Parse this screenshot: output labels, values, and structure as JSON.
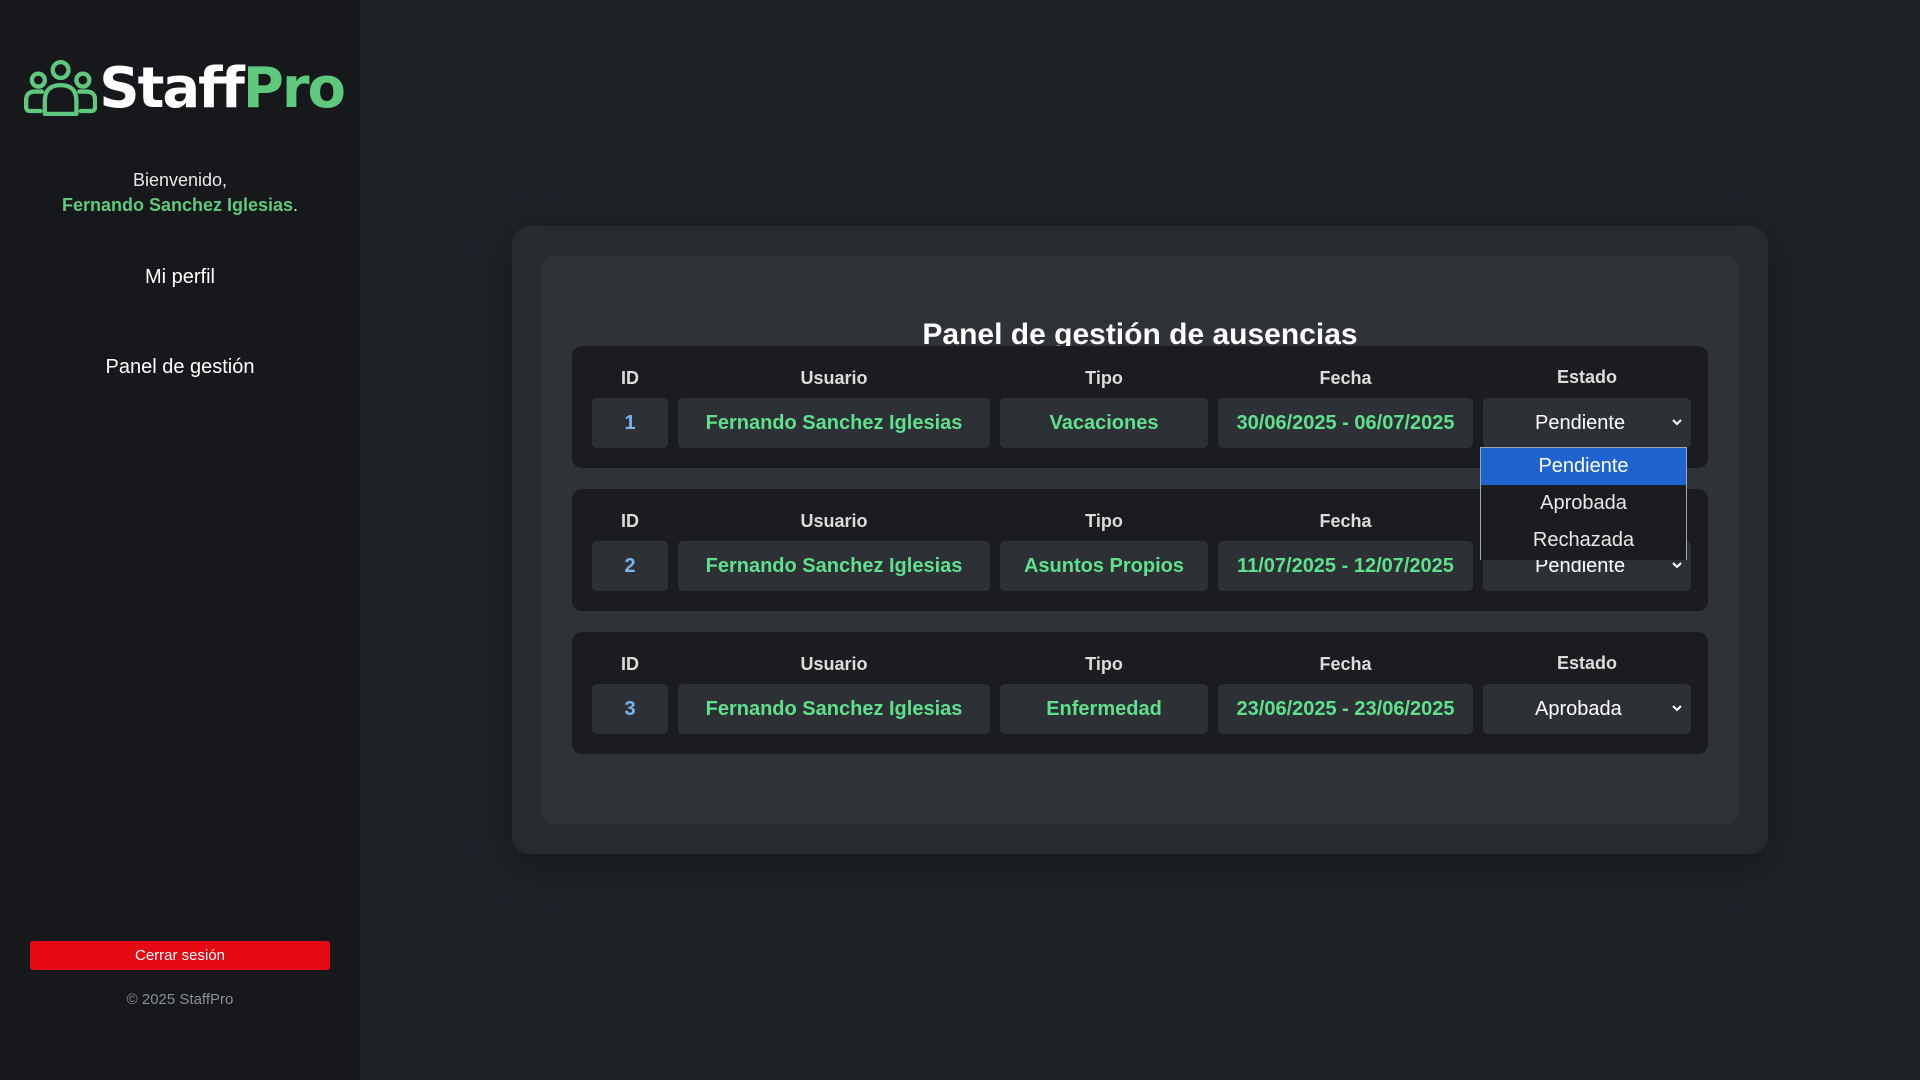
{
  "brand": {
    "name_part1": "Staff",
    "name_part2": "Pro",
    "accent_color": "#5ec97c",
    "icon": "users-group-icon"
  },
  "sidebar": {
    "welcome_label": "Bienvenido,",
    "user_name": "Fernando Sanchez Iglesias",
    "user_name_suffix": ".",
    "nav": [
      {
        "label": "Mi perfil"
      },
      {
        "label": "Panel de gestión"
      }
    ],
    "logout_label": "Cerrar sesión",
    "logout_color": "#e50913",
    "copyright": "© 2025 StaffPro"
  },
  "panel": {
    "title": "Panel de gestión de ausencias",
    "headers": {
      "id": "ID",
      "usuario": "Usuario",
      "tipo": "Tipo",
      "fecha": "Fecha",
      "estado": "Estado"
    },
    "rows": [
      {
        "id": "1",
        "usuario": "Fernando Sanchez Iglesias",
        "tipo": "Vacaciones",
        "fecha": "30/06/2025 - 06/07/2025",
        "estado": "Pendiente"
      },
      {
        "id": "2",
        "usuario": "Fernando Sanchez Iglesias",
        "tipo": "Asuntos Propios",
        "fecha": "11/07/2025 - 12/07/2025",
        "estado": "Pendiente"
      },
      {
        "id": "3",
        "usuario": "Fernando Sanchez Iglesias",
        "tipo": "Enfermedad",
        "fecha": "23/06/2025 - 23/06/2025",
        "estado": "Aprobada"
      }
    ]
  },
  "dropdown": {
    "open_for_row": "1",
    "options": [
      "Pendiente",
      "Aprobada",
      "Rechazada"
    ],
    "highlighted": "Pendiente",
    "highlight_color": "#1e63cf"
  }
}
